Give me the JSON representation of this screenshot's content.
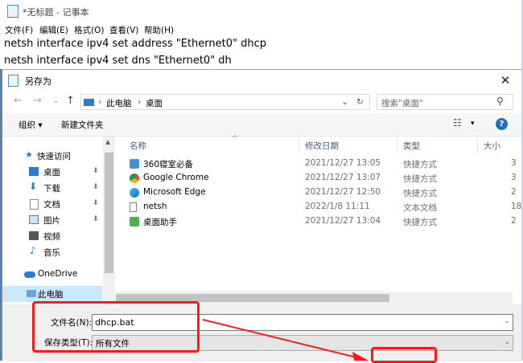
{
  "notepad": {
    "title": "*无标题 - 记事本",
    "menu": [
      "文件(F)",
      "编辑(E)",
      "格式(O)",
      "查看(V)",
      "帮助(H)"
    ],
    "lines": [
      "netsh interface ipv4 set address \"Ethernet0\" dhcp",
      "netsh interface ipv4 set dns \"Ethernet0\" dh"
    ]
  },
  "dialog": {
    "title": "另存为",
    "close_glyph": "✕",
    "nav": {
      "back": "←",
      "forward": "→",
      "recent": "⌄",
      "up": "↑"
    },
    "breadcrumb": [
      "此电脑",
      "桌面"
    ],
    "breadcrumb_sep": "›",
    "search_placeholder": "搜索\"桌面\"",
    "toolbar": {
      "organize": "组织 ▾",
      "new_folder": "新建文件夹",
      "view": "☷",
      "view_dd": "▾",
      "help": "?"
    },
    "sidebar": [
      {
        "label": "快速访问",
        "icon": "star-icon",
        "pinned": false
      },
      {
        "label": "桌面",
        "icon": "desktop-icon",
        "pinned": true
      },
      {
        "label": "下载",
        "icon": "download-icon",
        "pinned": true
      },
      {
        "label": "文档",
        "icon": "document-icon",
        "pinned": true
      },
      {
        "label": "图片",
        "icon": "pictures-icon",
        "pinned": true
      },
      {
        "label": "视频",
        "icon": "video-icon",
        "pinned": false
      },
      {
        "label": "音乐",
        "icon": "music-icon",
        "pinned": false
      },
      {
        "label": "OneDrive",
        "icon": "cloud-icon",
        "pinned": false
      },
      {
        "label": "此电脑",
        "icon": "computer-icon",
        "pinned": false
      }
    ],
    "pin_glyph": "📌",
    "columns": [
      "名称",
      "修改日期",
      "类型",
      "大小"
    ],
    "files": [
      {
        "name": "360寝室必备",
        "modified": "2021/12/27 13:05",
        "type": "快捷方式",
        "size": "3"
      },
      {
        "name": "Google Chrome",
        "modified": "2021/12/27 13:07",
        "type": "快捷方式",
        "size": "3"
      },
      {
        "name": "Microsoft Edge",
        "modified": "2021/12/27 12:50",
        "type": "快捷方式",
        "size": "2"
      },
      {
        "name": "netsh",
        "modified": "2022/1/8 11:11",
        "type": "文本文档",
        "size": "18"
      },
      {
        "name": "桌面助手",
        "modified": "2021/12/27 13:04",
        "type": "快捷方式",
        "size": "2"
      }
    ],
    "filename_label": "文件名(N):",
    "filename_value": "dhcp.bat",
    "filetype_label": "保存类型(T):",
    "filetype_value": "所有文件",
    "dropdown_glyph": "⌄"
  },
  "colors": {
    "annotation": "#ff1a1a",
    "accent": "#1f6fc2"
  }
}
